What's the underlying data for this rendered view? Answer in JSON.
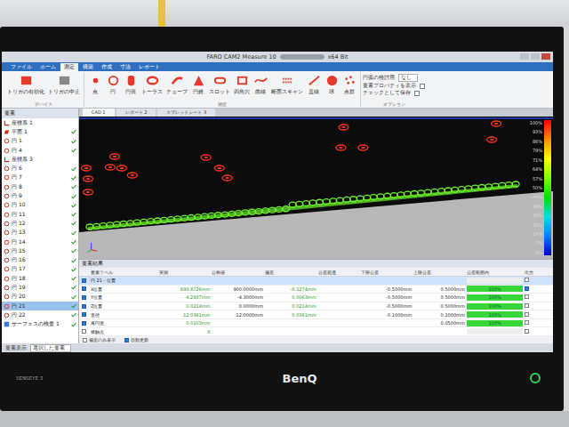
{
  "window": {
    "title": "FARO CAM2 Measure 10",
    "title_suffix": "x64 Bit"
  },
  "monitor": {
    "brand": "BenQ",
    "badge": "SENSEYE 3"
  },
  "ribbon_tabs": [
    {
      "label": "ファイル",
      "selected": false
    },
    {
      "label": "ホーム",
      "selected": false
    },
    {
      "label": "測定",
      "selected": true
    },
    {
      "label": "構築",
      "selected": false
    },
    {
      "label": "作成",
      "selected": false
    },
    {
      "label": "寸法",
      "selected": false
    },
    {
      "label": "レポート",
      "selected": false
    }
  ],
  "ribbon_groups": [
    {
      "label": "デバイス",
      "items": [
        "トリガの有効化",
        "トリガの中止"
      ]
    },
    {
      "label": "測定",
      "items": [
        "点",
        "円",
        "円筒",
        "トーラス",
        "チューブ",
        "円錐",
        "スロット",
        "四角穴",
        "曲線",
        "断面スキャン",
        "直線",
        "球",
        "点群"
      ]
    }
  ],
  "ribbon_options": {
    "label": "オプション",
    "dropdown_label": "円弧の検討用",
    "dropdown_value": "なし",
    "checks": [
      {
        "label": "要素プロパティを表示",
        "checked": false
      },
      {
        "label": "チェックとして保存",
        "checked": false
      }
    ]
  },
  "tree": {
    "title": "要素",
    "items": [
      {
        "label": "座標系 1",
        "kind": "coord",
        "selected": false,
        "visible": false
      },
      {
        "label": "平面 1",
        "kind": "plane",
        "selected": false,
        "visible": true
      },
      {
        "label": "円 1",
        "kind": "circle",
        "selected": false,
        "visible": true
      },
      {
        "label": "円 4",
        "kind": "circle",
        "selected": false,
        "visible": true
      },
      {
        "label": "座標系 3",
        "kind": "coord",
        "selected": false,
        "visible": false
      },
      {
        "label": "円 6",
        "kind": "circle",
        "selected": false,
        "visible": true
      },
      {
        "label": "円 7",
        "kind": "circle",
        "selected": false,
        "visible": true
      },
      {
        "label": "円 8",
        "kind": "circle",
        "selected": false,
        "visible": true
      },
      {
        "label": "円 9",
        "kind": "circle",
        "selected": false,
        "visible": true
      },
      {
        "label": "円 10",
        "kind": "circle",
        "selected": false,
        "visible": true
      },
      {
        "label": "円 11",
        "kind": "circle",
        "selected": false,
        "visible": true
      },
      {
        "label": "円 12",
        "kind": "circle",
        "selected": false,
        "visible": true
      },
      {
        "label": "円 13",
        "kind": "circle",
        "selected": false,
        "visible": true
      },
      {
        "label": "円 14",
        "kind": "circle",
        "selected": false,
        "visible": true
      },
      {
        "label": "円 15",
        "kind": "circle",
        "selected": false,
        "visible": true
      },
      {
        "label": "円 16",
        "kind": "circle",
        "selected": false,
        "visible": true
      },
      {
        "label": "円 17",
        "kind": "circle",
        "selected": false,
        "visible": true
      },
      {
        "label": "円 18",
        "kind": "circle",
        "selected": false,
        "visible": true
      },
      {
        "label": "円 19",
        "kind": "circle",
        "selected": false,
        "visible": true
      },
      {
        "label": "円 20",
        "kind": "circle",
        "selected": false,
        "visible": true
      },
      {
        "label": "円 21",
        "kind": "circle",
        "selected": true,
        "visible": true
      },
      {
        "label": "円 22",
        "kind": "circle",
        "selected": false,
        "visible": true
      },
      {
        "label": "サーフェスの検査 1",
        "kind": "surface",
        "selected": false,
        "visible": true
      }
    ]
  },
  "view_tabs": [
    {
      "label": "CAD 1",
      "selected": true
    },
    {
      "label": "レポート 2",
      "selected": false
    },
    {
      "label": "スプレッドシート 3",
      "selected": false
    }
  ],
  "view": {
    "markers": [
      {
        "color": "#ff3418"
      },
      {
        "color": "#ff3418"
      },
      {
        "color": "#ff3418"
      },
      {
        "color": "#ff3418"
      },
      {
        "color": "#ff3418"
      },
      {
        "color": "#ff3418"
      },
      {
        "color": "#ff3418"
      },
      {
        "color": "#ff3418"
      },
      {
        "color": "#ff3418"
      },
      {
        "color": "#ff3418"
      },
      {
        "color": "#ff3418"
      },
      {
        "color": "#ff3418"
      },
      {
        "color": "#ff3418"
      },
      {
        "color": "#ff3418"
      },
      {
        "color": "#ff3418"
      }
    ],
    "chain": {
      "color": "#6cf52a",
      "count": 64
    },
    "legend": [
      "100%",
      "93%",
      "86%",
      "79%",
      "71%",
      "64%",
      "57%",
      "50%",
      "43%",
      "36%",
      "29%",
      "21%",
      "14%",
      "7%",
      "0%"
    ]
  },
  "results": {
    "title": "要素結果",
    "columns": [
      "要素ラベル",
      "実測",
      "公称値",
      "偏差",
      "公差超過",
      "下限公差",
      "上限公差",
      "公差範囲内",
      "出力"
    ],
    "rows": [
      {
        "label": "円 21 - 位置",
        "selected": true,
        "checked": true,
        "measured": "",
        "nominal": "",
        "deviation": "",
        "exceed": "",
        "lower": "",
        "upper": "",
        "in_tol": "",
        "level": 0,
        "output": false
      },
      {
        "label": "X位置",
        "selected": false,
        "checked": true,
        "measured": "899.8726mm",
        "nominal": "900.0000mm",
        "deviation": "-0.1274mm",
        "exceed": "",
        "lower": "-0.5000mm",
        "upper": "0.5000mm",
        "in_tol": "100%",
        "level": 1,
        "output": true
      },
      {
        "label": "Y位置",
        "selected": false,
        "checked": true,
        "measured": "-4.2937mm",
        "nominal": "-4.3000mm",
        "deviation": "0.0063mm",
        "exceed": "",
        "lower": "-0.5000mm",
        "upper": "0.5000mm",
        "in_tol": "100%",
        "level": 1,
        "output": false
      },
      {
        "label": "Z位置",
        "selected": false,
        "checked": true,
        "measured": "0.0214mm",
        "nominal": "0.0000mm",
        "deviation": "0.0214mm",
        "exceed": "",
        "lower": "-0.5000mm",
        "upper": "0.5000mm",
        "in_tol": "100%",
        "level": 1,
        "output": false
      },
      {
        "label": "直径",
        "selected": false,
        "checked": true,
        "measured": "12.0381mm",
        "nominal": "12.0000mm",
        "deviation": "0.0381mm",
        "exceed": "",
        "lower": "-0.1000mm",
        "upper": "0.1000mm",
        "in_tol": "100%",
        "level": 1,
        "output": false
      },
      {
        "label": "真円度",
        "selected": false,
        "checked": true,
        "measured": "0.0103mm",
        "nominal": "",
        "deviation": "",
        "exceed": "",
        "lower": "",
        "upper": "0.0500mm",
        "in_tol": "100%",
        "level": 1,
        "output": false
      },
      {
        "label": "接触点",
        "selected": false,
        "checked": false,
        "measured": "8",
        "nominal": "",
        "deviation": "",
        "exceed": "",
        "lower": "",
        "upper": "",
        "in_tol": "",
        "level": 0,
        "output": false
      }
    ],
    "footer": [
      {
        "label": "偏差のみ表示",
        "checked": false
      },
      {
        "label": "自動更新",
        "checked": true
      }
    ]
  },
  "status_bar": {
    "text": "要素表示",
    "value": "選択した要素"
  }
}
